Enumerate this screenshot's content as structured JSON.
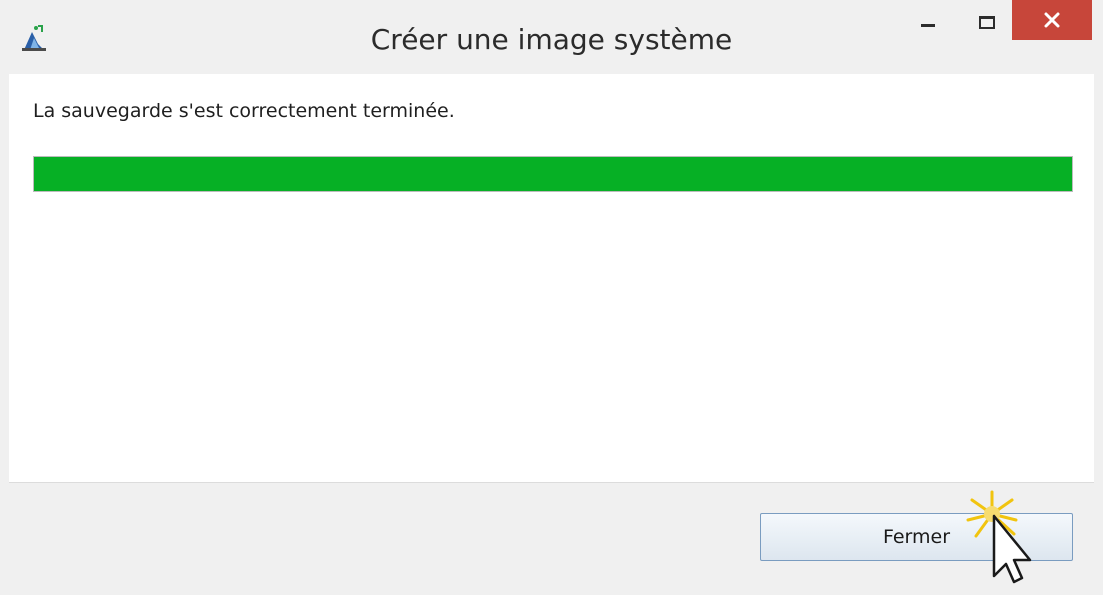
{
  "window": {
    "title": "Créer une image système"
  },
  "content": {
    "status_message": "La sauvegarde s'est correctement terminée.",
    "progress_fraction": 1.0
  },
  "footer": {
    "close_button_label": "Fermer"
  },
  "colors": {
    "progress_fill": "#06b025",
    "close_control": "#c7463a",
    "button_border": "#7a9cc0"
  },
  "icons": {
    "app": "backup-app-icon",
    "minimize": "minimize-icon",
    "maximize": "maximize-icon",
    "close": "close-icon",
    "cursor": "mouse-pointer-icon"
  }
}
